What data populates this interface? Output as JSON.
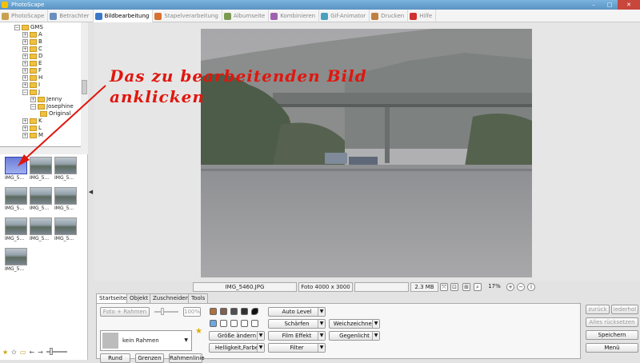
{
  "window": {
    "title": "PhotoScape",
    "min": "–",
    "max": "□",
    "close": "✕"
  },
  "tabs": [
    {
      "label": "PhotoScape",
      "color": "#c8a050"
    },
    {
      "label": "Betrachter",
      "color": "#6a8fbf"
    },
    {
      "label": "Bildbearbeitung",
      "color": "#3c78c8"
    },
    {
      "label": "Stapelverarbeitung",
      "color": "#d87030"
    },
    {
      "label": "Albumseite",
      "color": "#7a9a50"
    },
    {
      "label": "Kombinieren",
      "color": "#a060b0"
    },
    {
      "label": "Gif-Animator",
      "color": "#4aa0c0"
    },
    {
      "label": "Drucken",
      "color": "#c08040"
    },
    {
      "label": "Hilfe",
      "color": "#d03030"
    }
  ],
  "tree": {
    "root": "GMS",
    "letters": [
      "A",
      "B",
      "C",
      "D",
      "E",
      "F",
      "H",
      "I",
      "J"
    ],
    "j_children": [
      "Jenny",
      "Josephine"
    ],
    "josephine_child": "Original",
    "more": [
      "K",
      "L",
      "M"
    ]
  },
  "thumbnails": [
    "IMG_5...",
    "IMG_5...",
    "IMG_5...",
    "IMG_5...",
    "IMG_5...",
    "IMG_5...",
    "IMG_5...",
    "IMG_5...",
    "IMG_5...",
    "IMG_5..."
  ],
  "annotation": {
    "line1": "Das zu bearbeitenden Bild",
    "line2": "anklicken",
    "color": "#e0160e"
  },
  "status": {
    "filename": "IMG_5460.JPG",
    "dimensions": "Foto 4000 x 3000",
    "size": "2.3 MB",
    "zoom": "17%"
  },
  "tool_tabs": [
    "Startseite",
    "Objekt",
    "Zuschneiden",
    "Tools"
  ],
  "panel": {
    "photo_frame": "Foto + Rahmen",
    "frame_percent": "100%",
    "frame_select": "kein Rahmen",
    "btn_round": "Rund",
    "btn_borders": "Grenzen",
    "btn_frameline": "Rahmenlinie",
    "btn_resize": "Größe ändern",
    "btn_brightness": "Helligkeit,Farbe",
    "btn_autolevel": "Auto Level",
    "btn_sharpen": "Schärfen",
    "btn_filmeffect": "Film Effekt",
    "btn_filter": "Filter",
    "btn_soften": "Weichzeichnen",
    "btn_backlight": "Gegenlicht"
  },
  "side": {
    "undo": "zurück",
    "redo": "lederhol",
    "reset": "Alles rücksetzen",
    "save": "Speichern",
    "menu": "Menü"
  }
}
